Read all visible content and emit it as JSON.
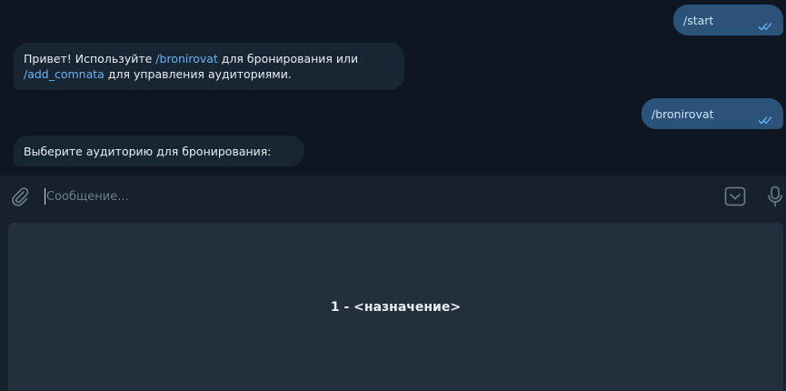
{
  "messages": [
    {
      "direction": "outgoing",
      "text": "/start",
      "status": "read"
    },
    {
      "direction": "incoming",
      "parts": [
        "Привет! Используйте ",
        "/bronirovat",
        " для бронирования или",
        "/add_comnata",
        " для управления аудиториями."
      ]
    },
    {
      "direction": "outgoing",
      "text": "/bronirovat",
      "status": "read"
    },
    {
      "direction": "incoming",
      "text": "Выберите аудиторию для бронирования:"
    }
  ],
  "composer": {
    "placeholder": "Сообщение...",
    "value": ""
  },
  "icons": {
    "attach": "paperclip-icon",
    "keyboard": "bot-keyboard-icon",
    "voice": "microphone-icon"
  },
  "reply_keyboard": {
    "buttons": [
      "1 - <назначение>"
    ]
  },
  "colors": {
    "background": "#0e1621",
    "outgoing_bubble": "#2b5278",
    "incoming_bubble": "#182533",
    "link": "#6ab3f3",
    "panel": "#17212b",
    "keyboard_button": "#242f3d"
  }
}
